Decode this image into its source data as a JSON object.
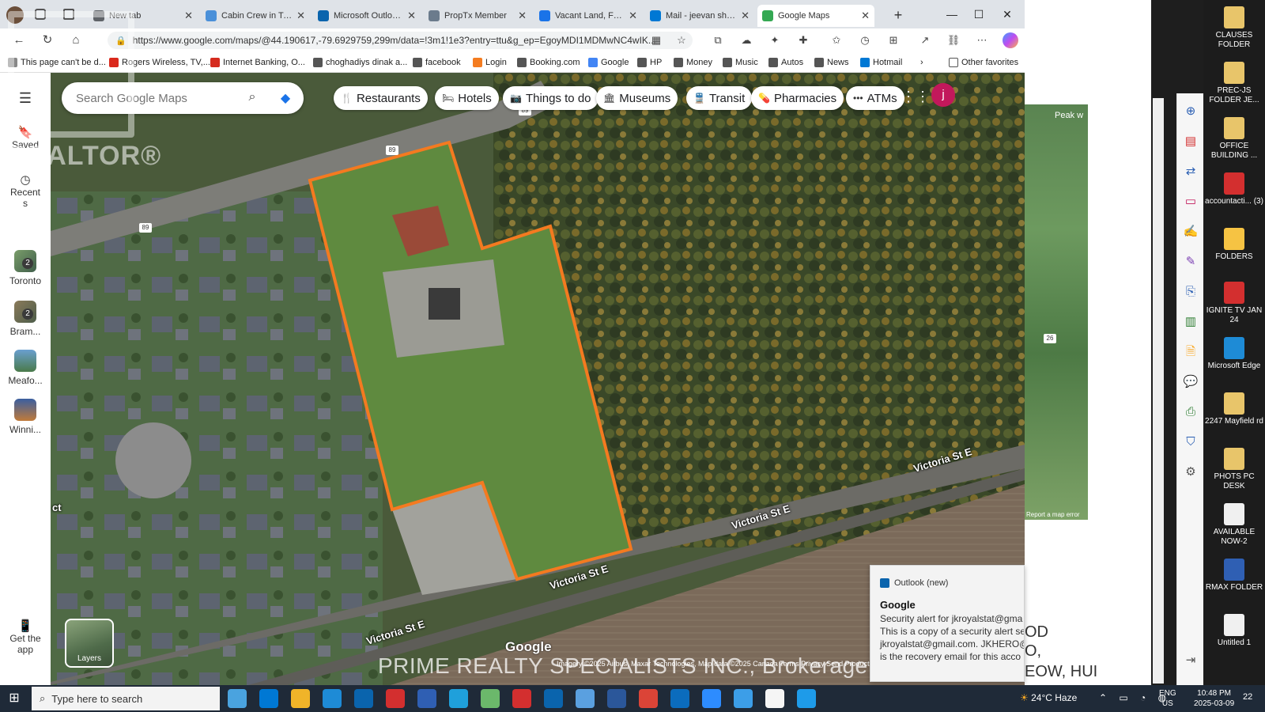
{
  "browser": {
    "tabs": [
      {
        "title": "New tab",
        "color": "#5f6368"
      },
      {
        "title": "Cabin Crew in T-shirt",
        "color": "#4a90d9"
      },
      {
        "title": "Microsoft Outlook (fe",
        "color": "#0a64ad"
      },
      {
        "title": "PropTx Member",
        "color": "#6b7b8c"
      },
      {
        "title": "Vacant Land, Farm, C",
        "color": "#1a73e8"
      },
      {
        "title": "Mail - jeevan sharma",
        "color": "#0078d4"
      },
      {
        "title": "Google Maps",
        "color": "#34a853",
        "active": true
      }
    ],
    "address": "https://www.google.com/maps/@44.190617,-79.6929759,299m/data=!3m1!1e3?entry=ttu&g_ep=EgoyMDI1MDMwNC4wIK...",
    "favorites": [
      {
        "label": "This page can't be d...",
        "color": "#888888"
      },
      {
        "label": "Rogers Wireless, TV,...",
        "color": "#da291c"
      },
      {
        "label": "Internet Banking, O...",
        "color": "#d52b1e"
      },
      {
        "label": "choghadiys dinak a...",
        "color": "#555555"
      },
      {
        "label": "facebook",
        "color": "#555555"
      },
      {
        "label": "Login",
        "color": "#f47c20"
      },
      {
        "label": "Booking.com",
        "color": "#555555"
      },
      {
        "label": "Google",
        "color": "#4285f4"
      },
      {
        "label": "HP",
        "color": "#555555"
      },
      {
        "label": "Money",
        "color": "#555555"
      },
      {
        "label": "Music",
        "color": "#555555"
      },
      {
        "label": "Autos",
        "color": "#555555"
      },
      {
        "label": "News",
        "color": "#555555"
      },
      {
        "label": "Hotmail",
        "color": "#0078d4"
      }
    ],
    "other_favorites": "Other favorites"
  },
  "maps": {
    "search_placeholder": "Search Google Maps",
    "sidebar": [
      {
        "label": "Saved",
        "icon": "bookmark-icon"
      },
      {
        "label": "Recents",
        "icon": "history-icon"
      },
      {
        "label": "Toronto",
        "badge": "2"
      },
      {
        "label": "Bram...",
        "badge": "2"
      },
      {
        "label": "Meafo..."
      },
      {
        "label": "Winni..."
      }
    ],
    "get_app": "Get the app",
    "chips": [
      {
        "label": "Restaurants",
        "icon": "restaurant-icon",
        "glyph": "🍴"
      },
      {
        "label": "Hotels",
        "icon": "hotel-icon",
        "glyph": "🛏"
      },
      {
        "label": "Things to do",
        "icon": "camera-icon",
        "glyph": "📷"
      },
      {
        "label": "Museums",
        "icon": "museum-icon",
        "glyph": "🏛"
      },
      {
        "label": "Transit",
        "icon": "transit-icon",
        "glyph": "🚆"
      },
      {
        "label": "Pharmacies",
        "icon": "pharmacy-icon",
        "glyph": "💊"
      },
      {
        "label": "ATMs",
        "icon": "atm-icon",
        "glyph": "•••"
      }
    ],
    "avatar_initial": "j",
    "layers_label": "Layers",
    "road_labels": {
      "victoria_1": "Victoria St E",
      "victoria_2": "Victoria St E",
      "victoria_3": "Victoria St E",
      "victoria_4": "Victoria St E",
      "route_89": "89",
      "route_89b": "89",
      "route_89c": "89",
      "ct": "ct"
    },
    "google_logo": "Google",
    "attribution": "Imagery ©2025 Airbus, Maxar Technologies, Map data ©2025   Canada   Terms   Privacy   Send Product Feedback   20 m",
    "parcel_outline_color": "#f47a20"
  },
  "watermark": {
    "realtor": "REALTOR®",
    "brokerage": "PRIME REALTY SPECIALISTS INC., Brokerage"
  },
  "right_panel": {
    "peak_label": "Peak w",
    "report_error": "Report a map error",
    "route_badge": "26",
    "overflow_text_1": "OD",
    "overflow_text_2": "O,",
    "overflow_text_3": "EOW, HUI"
  },
  "notification": {
    "app": "Outlook (new)",
    "title": "Google",
    "body": [
      "Security alert for jkroyalstat@gma",
      "This is a copy of a security alert se",
      "jkroyalstat@gmail.com. JKHERO@",
      "is the recovery email for this acco"
    ]
  },
  "desktop_icons": [
    {
      "label": "CLAUSES FOLDER",
      "color": "#e8c56a"
    },
    {
      "label": "PREC-JS FOLDER JE...",
      "color": "#e8c56a"
    },
    {
      "label": "OFFICE BUILDING ...",
      "color": "#e8c56a"
    },
    {
      "label": "accountacti... (3)",
      "color": "#d32f2f"
    },
    {
      "label": "FOLDERS",
      "color": "#f6c343"
    },
    {
      "label": "IGNITE TV JAN 24",
      "color": "#d32f2f"
    },
    {
      "label": "Microsoft Edge",
      "color": "#1e8bd6"
    },
    {
      "label": "2247 Mayfield rd",
      "color": "#e8c56a"
    },
    {
      "label": "PHOTS PC DESK",
      "color": "#e8c56a"
    },
    {
      "label": "AVAILABLE NOW-2",
      "color": "#f0f0f0"
    },
    {
      "label": "RMAX FOLDER",
      "color": "#2f5fb3"
    },
    {
      "label": "Untitled 1",
      "color": "#f0f0f0"
    }
  ],
  "taskbar": {
    "search_placeholder": "Type here to search",
    "apps": [
      "#4aa3df",
      "#0078d4",
      "#f0b429",
      "#1e8bd6",
      "#0a64ad",
      "#d32f2f",
      "#2f5fb3",
      "#1fa0db",
      "#6bb86b",
      "#d32f2f",
      "#0a64ad",
      "#5aa0e0",
      "#2b579a",
      "#db4437",
      "#0b6cbd",
      "#2d8cff",
      "#3c9ee8",
      "#f5f5f5",
      "#1e9be9"
    ],
    "weather": "24°C  Haze",
    "lang": [
      "ENG",
      "US"
    ],
    "time": "10:48 PM",
    "date": "2025-03-09",
    "notif_count": "22"
  }
}
